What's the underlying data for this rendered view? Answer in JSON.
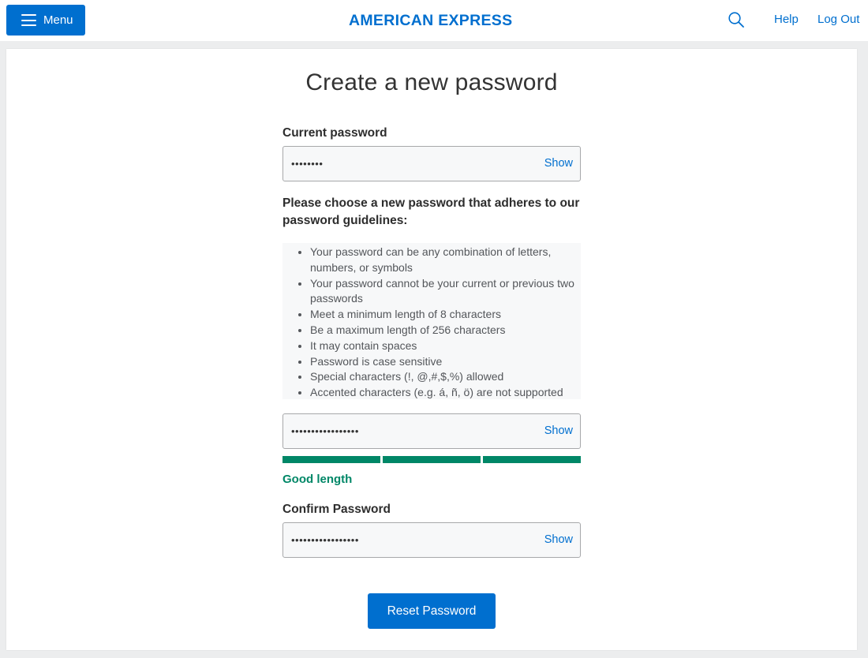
{
  "header": {
    "menu_label": "Menu",
    "logo_text": "AMERICAN EXPRESS",
    "help_label": "Help",
    "logout_label": "Log Out"
  },
  "page": {
    "title": "Create a new password"
  },
  "current_password": {
    "label": "Current password",
    "value": "••••••••",
    "show_label": "Show"
  },
  "instructions": "Please choose a new password that adheres to our password guidelines:",
  "guidelines": [
    "Your password can be any combination of letters, numbers, or symbols",
    "Your password cannot be your current or previous two passwords",
    "Meet a minimum length of 8 characters",
    "Be a maximum length of 256 characters",
    "It may contain spaces",
    "Password is case sensitive",
    "Special characters (!, @,#,$,%) allowed",
    "Accented characters (e.g. á, ñ, ö) are not supported"
  ],
  "new_password": {
    "value": "•••••••••••••••••",
    "show_label": "Show",
    "strength_segments_filled": 3,
    "strength_segments_total": 3,
    "strength_text": "Good length"
  },
  "confirm_password": {
    "label": "Confirm Password",
    "value": "•••••••••••••••••",
    "show_label": "Show"
  },
  "reset_button_label": "Reset Password",
  "colors": {
    "brand_blue": "#006fcf",
    "success_green": "#008767",
    "page_background": "#ecedee"
  }
}
